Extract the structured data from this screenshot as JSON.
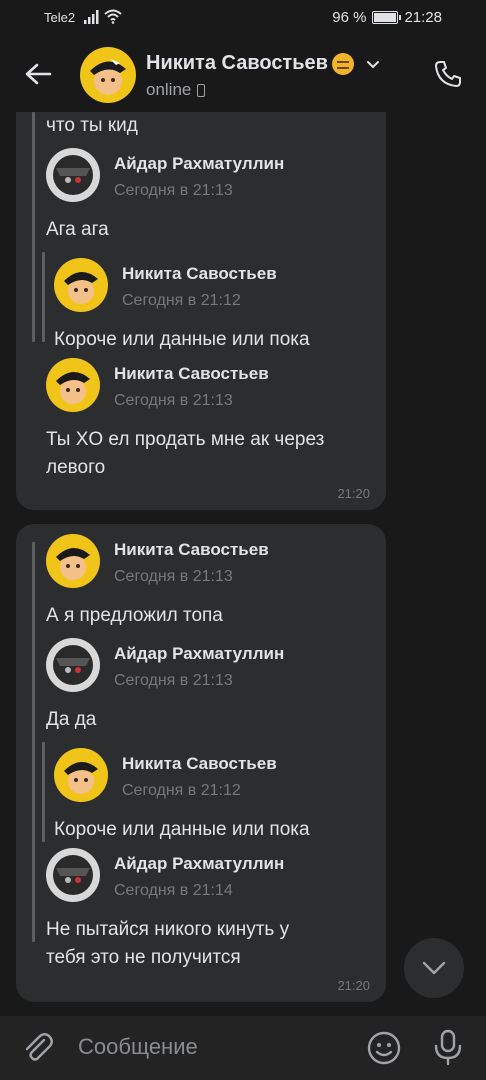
{
  "status_bar": {
    "carrier": "Tele2",
    "battery": "96 %",
    "battery_level": 0.96,
    "time": "21:28"
  },
  "header": {
    "contact_name": "Никита Савостьев",
    "status": "online"
  },
  "messages": [
    {
      "text_top": "что ты кид",
      "fwd1": {
        "author": "Айдар Рахматуллин",
        "date": "Сегодня в 21:13",
        "text": "Ага ага"
      },
      "nested": {
        "author": "Никита Савостьев",
        "date": "Сегодня в 21:12",
        "text": "Короче или данные или пока"
      },
      "fwd2": {
        "author": "Никита Савостьев",
        "date": "Сегодня в 21:13",
        "text_line1": "Ты XO ел продать мне ак через",
        "text_line2": "левого"
      },
      "time": "21:20"
    },
    {
      "fwd1": {
        "author": "Никита Савостьев",
        "date": "Сегодня в 21:13",
        "text": "А я предложил топа"
      },
      "fwd2": {
        "author": "Айдар Рахматуллин",
        "date": "Сегодня в 21:13",
        "text": "Да да"
      },
      "nested": {
        "author": "Никита Савостьев",
        "date": "Сегодня в 21:12",
        "text": "Короче или данные или пока"
      },
      "fwd3": {
        "author": "Айдар Рахматуллин",
        "date": "Сегодня в 21:14",
        "text_line1": "Не пытайся никого кинуть у",
        "text_line2": "тебя это не получится"
      },
      "time": "21:20"
    }
  ],
  "composer": {
    "placeholder": "Сообщение"
  },
  "colors": {
    "background": "#19191a",
    "bubble": "#2c2d2e",
    "text": "#e1e3e6",
    "secondary": "#76787a"
  }
}
